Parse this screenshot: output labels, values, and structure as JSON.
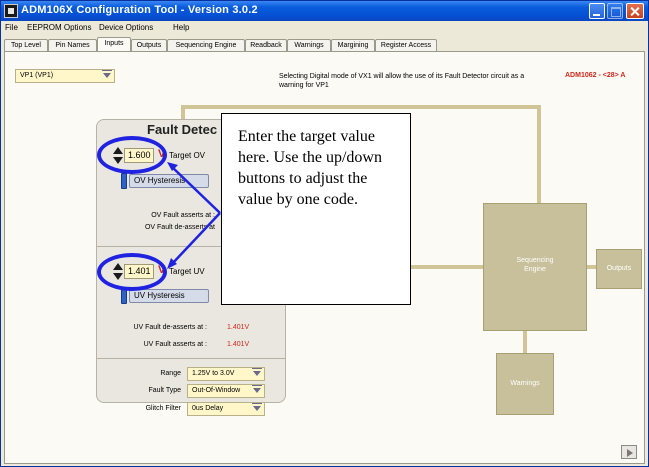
{
  "window": {
    "title": "ADM106X Configuration Tool - Version 3.0.2"
  },
  "menu": [
    "File",
    "EEPROM Options",
    "Device Options",
    "Help"
  ],
  "tabs": [
    {
      "label": "Top Level"
    },
    {
      "label": "Pin Names"
    },
    {
      "label": "Inputs",
      "active": true
    },
    {
      "label": "Outputs"
    },
    {
      "label": "Sequencing Engine"
    },
    {
      "label": "Readback"
    },
    {
      "label": "Warnings"
    },
    {
      "label": "Margining"
    },
    {
      "label": "Register Access"
    }
  ],
  "input_select": {
    "value": "VP1 (VP1)"
  },
  "info_text": "Selecting Digital mode of VX1 will allow the use of its Fault Detector circuit as a warning for VP1",
  "part_label": "ADM1062 - <28> A",
  "fault_detector": {
    "title": "Fault Detec",
    "ov": {
      "value": "1.600",
      "unit": "V",
      "target_label": "Target OV",
      "hysteresis_label": "OV Hysteresis",
      "asserts_label": "OV Fault asserts at :",
      "deasserts_label": "OV Fault de-asserts at"
    },
    "uv": {
      "value": "1.401",
      "unit": "V",
      "target_label": "Target UV",
      "hysteresis_label": "UV Hysteresis",
      "deasserts_label": "UV Fault de-asserts at :",
      "deasserts_value": "1.401V",
      "asserts_label": "UV Fault asserts at :",
      "asserts_value": "1.401V"
    },
    "range_label": "Range",
    "range_value": "1.25V to 3.0V",
    "fault_type_label": "Fault Type",
    "fault_type_value": "Out-Of-Window",
    "glitch_filter_label": "Glitch Filter",
    "glitch_filter_value": "0us Delay"
  },
  "blocks": {
    "sequencing_engine": "Sequencing Engine",
    "outputs": "Outputs",
    "warnings": "Warnings"
  },
  "callout": "Enter the target value here. Use the up/down buttons to adjust the value by one code.",
  "colors": {
    "title_bar": "#0551d6",
    "highlight_ring": "#1f22e0",
    "value_red": "#d0281c",
    "block_fill": "#c7c09a"
  }
}
